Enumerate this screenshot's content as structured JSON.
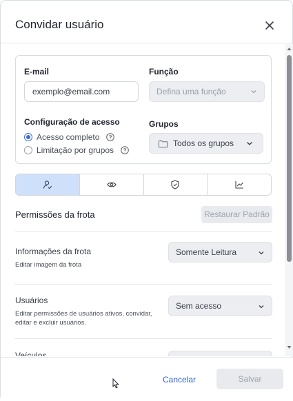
{
  "dialog": {
    "title": "Convidar usuário"
  },
  "form": {
    "email_label": "E-mail",
    "email_placeholder": "exemplo@email.com",
    "function_label": "Função",
    "function_placeholder": "Defina uma função",
    "access_label": "Configuração de acesso",
    "access_options": [
      {
        "label": "Acesso completo",
        "selected": true
      },
      {
        "label": "Limitação por grupos",
        "selected": false
      }
    ],
    "groups_label": "Grupos",
    "groups_value": "Todos os grupos"
  },
  "tabs": [
    {
      "icon": "user-check-icon",
      "active": true
    },
    {
      "icon": "eye-icon",
      "active": false
    },
    {
      "icon": "shield-check-icon",
      "active": false
    },
    {
      "icon": "line-chart-icon",
      "active": false
    }
  ],
  "permissions": {
    "title": "Permissões da frota",
    "restore_label": "Restaurar Padrão",
    "items": [
      {
        "name": "Informações da frota",
        "description": "Editar imagem da frota",
        "value": "Somente Leitura"
      },
      {
        "name": "Usuários",
        "description": "Editar permissões de usuários ativos, convidar, editar e excluir usuários.",
        "value": "Sem acesso"
      },
      {
        "name": "Veículos",
        "description": "",
        "value": ""
      }
    ]
  },
  "footer": {
    "cancel_label": "Cancelar",
    "save_label": "Salvar"
  },
  "colors": {
    "accent": "#2d62c8",
    "active_tab": "#cfe0fb",
    "disabled_bg": "#e8eaee"
  }
}
